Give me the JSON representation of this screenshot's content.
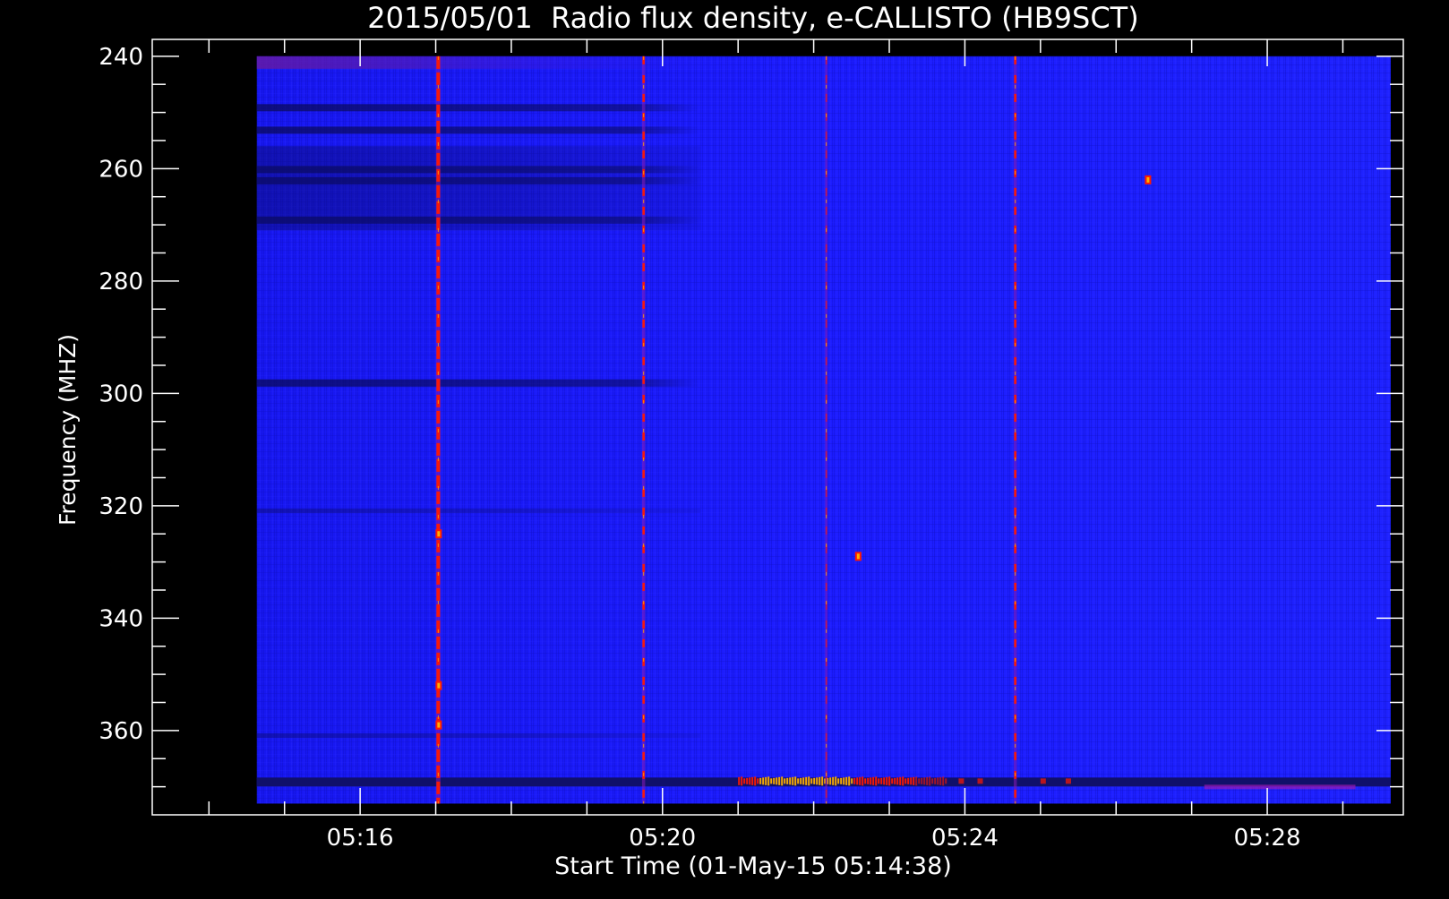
{
  "chart_data": {
    "type": "heatmap",
    "title": "2015/05/01  Radio flux density, e-CALLISTO (HB9SCT)",
    "xlabel": "Start Time (01-May-15 05:14:38)",
    "ylabel": "Frequency (MHZ)",
    "y_axis": {
      "range": [
        237,
        375
      ],
      "inverted": true,
      "major_ticks": [
        240,
        260,
        280,
        300,
        320,
        340,
        360
      ],
      "major_tick_labels": [
        "240",
        "260",
        "280",
        "300",
        "320",
        "340",
        "360"
      ],
      "minor_step": 5
    },
    "x_axis": {
      "range_minutes_after_0514": [
        -0.75,
        15.8
      ],
      "major_ticks_minutes": [
        2,
        6,
        10,
        14
      ],
      "major_tick_labels": [
        "05:16",
        "05:20",
        "05:24",
        "05:28"
      ],
      "minor_step_minutes": 1
    },
    "data_extent": {
      "time_start": "05:14:38",
      "time_end": "05:29:38",
      "freq_top_mhz": 240,
      "freq_bottom_mhz": 373
    },
    "colormap": {
      "background": "#1a1aff",
      "dark_band": "#0a0a55",
      "hot": [
        "#ff1a00",
        "#ffb000",
        "#ffff80"
      ]
    },
    "dark_bands_mhz": [
      249,
      253,
      260,
      262,
      269,
      298,
      321,
      361
    ],
    "bright_lines": [
      {
        "time": "05:17:02",
        "intensity": "strong"
      },
      {
        "time": "05:19:45",
        "intensity": "medium"
      },
      {
        "time": "05:22:10",
        "intensity": "weak"
      },
      {
        "time": "05:24:40",
        "intensity": "medium"
      }
    ],
    "bright_spots": [
      {
        "time": "05:17:02",
        "freq_mhz": 325
      },
      {
        "time": "05:17:02",
        "freq_mhz": 352
      },
      {
        "time": "05:17:02",
        "freq_mhz": 359
      },
      {
        "time": "05:22:35",
        "freq_mhz": 329
      },
      {
        "time": "05:26:25",
        "freq_mhz": 262
      }
    ],
    "bottom_band": {
      "freq_mhz": 369,
      "hot_segment": {
        "start": "05:21:00",
        "end": "05:23:45"
      },
      "faint_segment": {
        "start": "05:27:10",
        "end": "05:29:10"
      }
    }
  }
}
